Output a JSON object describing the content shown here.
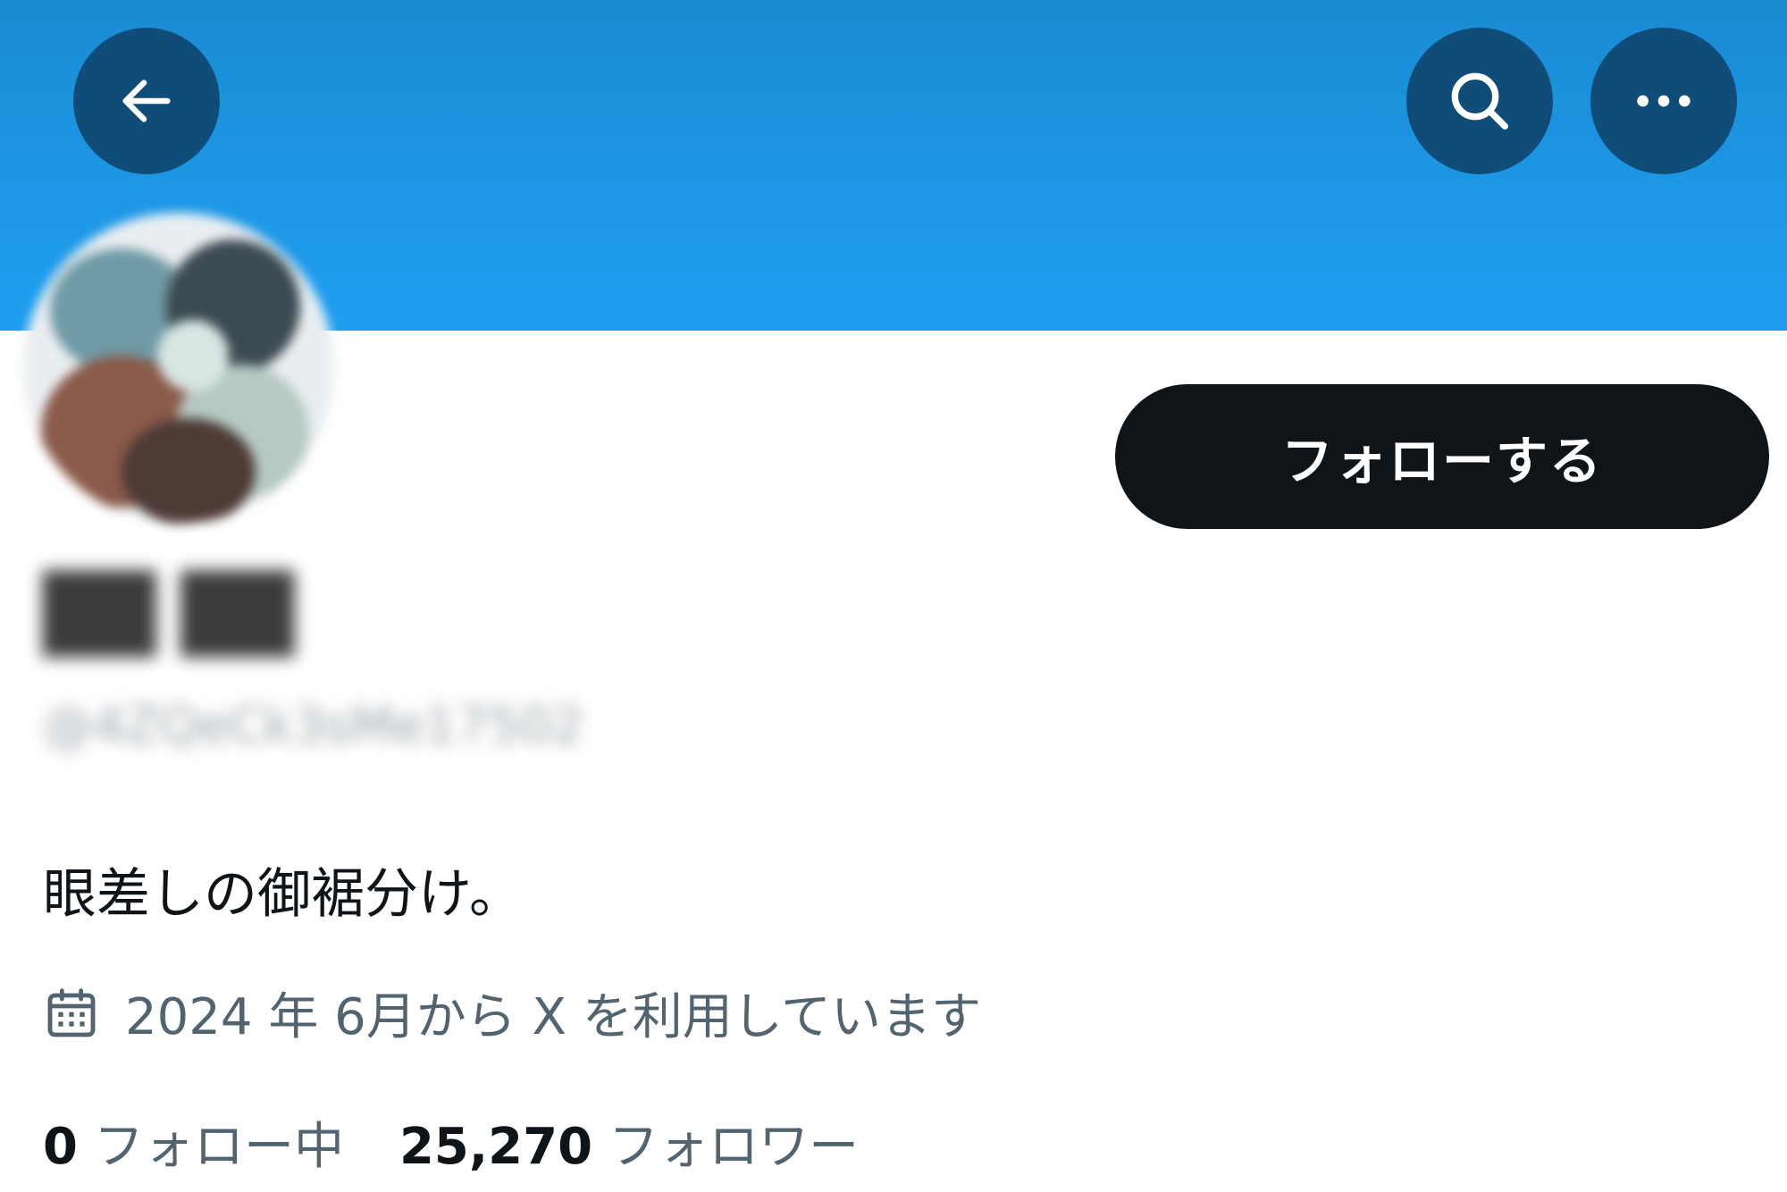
{
  "header": {
    "back_icon": "arrow-left-icon",
    "search_icon": "search-icon",
    "more_icon": "more-horizontal-icon",
    "banner_color": "#1d97e6",
    "button_color": "#0f4d78"
  },
  "profile": {
    "display_name": "██ ██",
    "handle": "@4ZQeCk3sMe17502",
    "follow_label": "フォローする",
    "bio": "眼差しの御裾分け。",
    "joined": "2024 年 6月から X を利用しています",
    "joined_icon": "calendar-icon"
  },
  "stats": {
    "following_count": "0",
    "following_label": "フォロー中",
    "followers_count": "25,270",
    "followers_label": "フォロワー"
  },
  "colors": {
    "follow_button": "#0f1419",
    "secondary_text": "#536471"
  }
}
